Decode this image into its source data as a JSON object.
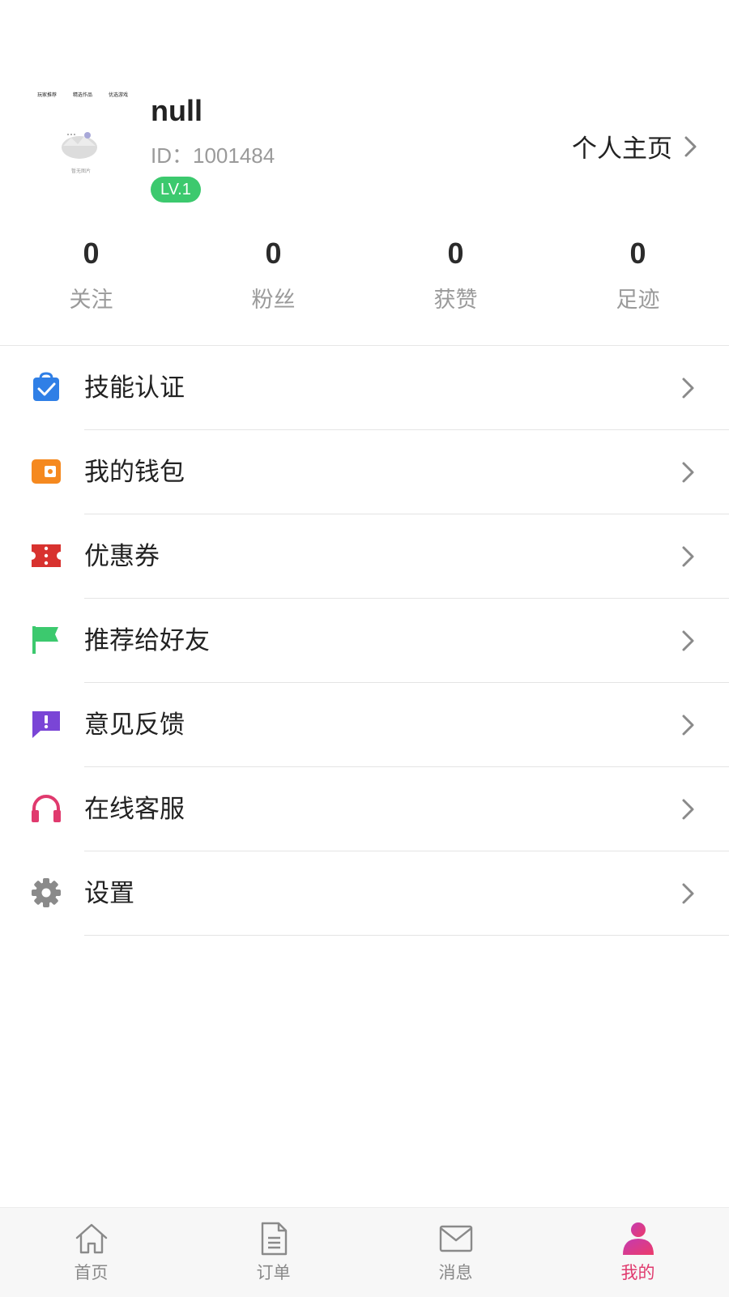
{
  "profile": {
    "avatar_mini_labels": [
      "玩家推荐",
      "精选作品",
      "优选游戏"
    ],
    "avatar_caption": "暂无图片",
    "name": "null",
    "id_text": "ID：1001484",
    "level": "LV.1",
    "homepage_label": "个人主页"
  },
  "stats": [
    {
      "value": "0",
      "label": "关注"
    },
    {
      "value": "0",
      "label": "粉丝"
    },
    {
      "value": "0",
      "label": "获赞"
    },
    {
      "value": "0",
      "label": "足迹"
    }
  ],
  "menu": [
    {
      "label": "技能认证",
      "icon": "bag-check-icon",
      "color": "#2f7fe6"
    },
    {
      "label": "我的钱包",
      "icon": "wallet-icon",
      "color": "#f5891f"
    },
    {
      "label": "优惠券",
      "icon": "coupon-icon",
      "color": "#d8322f"
    },
    {
      "label": "推荐给好友",
      "icon": "flag-icon",
      "color": "#3cc96e"
    },
    {
      "label": "意见反馈",
      "icon": "feedback-icon",
      "color": "#7a45d6"
    },
    {
      "label": "在线客服",
      "icon": "headset-icon",
      "color": "#e03a6e"
    },
    {
      "label": "设置",
      "icon": "gear-icon",
      "color": "#8a8a8a"
    }
  ],
  "tabs": [
    {
      "label": "首页",
      "icon": "home-icon",
      "active": false
    },
    {
      "label": "订单",
      "icon": "document-icon",
      "active": false
    },
    {
      "label": "消息",
      "icon": "mail-icon",
      "active": false
    },
    {
      "label": "我的",
      "icon": "person-icon",
      "active": true
    }
  ],
  "colors": {
    "accent": "#e03a6e",
    "level_badge": "#3cc96e",
    "tabbar_bg": "#f7f7f7"
  }
}
